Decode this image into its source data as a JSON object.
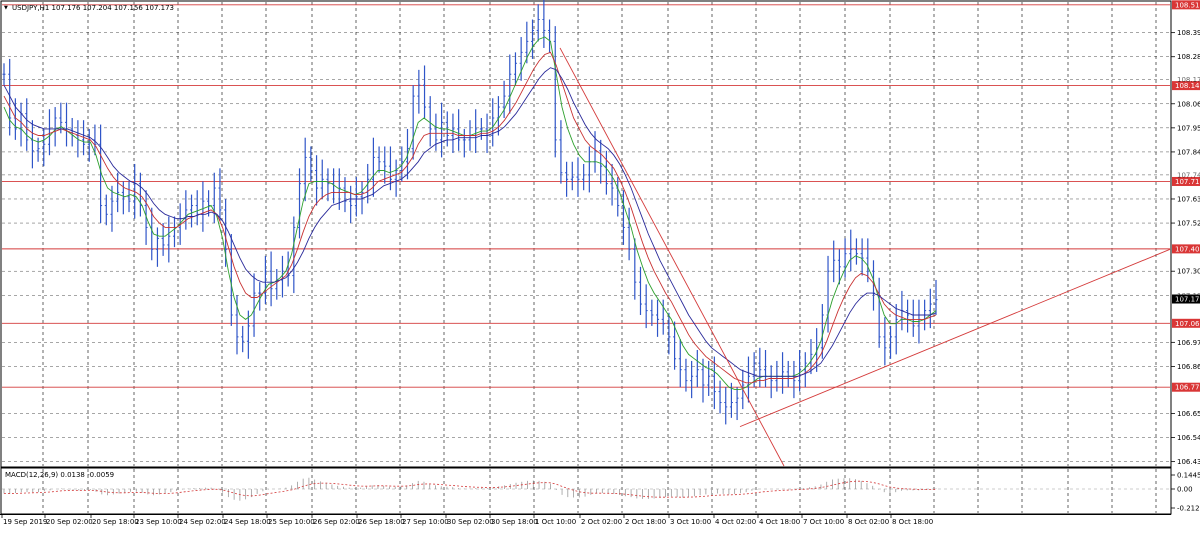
{
  "header": {
    "dropdown_glyph": "▼",
    "symbol_info": "USDJPY,H1  107.176 107.204 107.156 107.173"
  },
  "macd": {
    "label": "MACD(12,26,9) 0.0138 -0.0059",
    "ticks": [
      "0.1445",
      "0.00",
      "-0.2128"
    ]
  },
  "chart_data": {
    "type": "line",
    "title": "USDJPY,H1",
    "price_ticks": [
      "108.390",
      "108.280",
      "108.065",
      "107.955",
      "107.845",
      "107.630",
      "107.520",
      "107.300",
      "106.975",
      "106.865",
      "106.650",
      "106.540",
      "106.430"
    ],
    "price_partial_ticks": [
      "108.175",
      "107.740",
      "107.190"
    ],
    "ylim": [
      106.41,
      108.53
    ],
    "time_labels": [
      "19 Sep 2019",
      "20 Sep 02:00",
      "20 Sep 18:00",
      "23 Sep 10:00",
      "24 Sep 02:00",
      "24 Sep 18:00",
      "25 Sep 10:00",
      "26 Sep 02:00",
      "26 Sep 18:00",
      "27 Sep 10:00",
      "30 Sep 02:00",
      "30 Sep 18:00",
      "1 Oct 10:00",
      "2 Oct 02:00",
      "2 Oct 18:00",
      "3 Oct 10:00",
      "4 Oct 02:00",
      "4 Oct 18:00",
      "7 Oct 10:00",
      "8 Oct 02:00",
      "8 Oct 18:00"
    ],
    "current_price": "107.173",
    "levels": [
      "108.517",
      "108.148",
      "107.710",
      "107.402",
      "107.062",
      "106.770"
    ],
    "series": [
      {
        "name": "USDJPY close",
        "color": "#2f55c8",
        "values": [
          108.2,
          108.0,
          107.95,
          108.02,
          107.9,
          107.85,
          107.86,
          107.88,
          107.95,
          108.0,
          107.98,
          107.95,
          107.92,
          107.9,
          107.88,
          107.9,
          107.88,
          107.6,
          107.56,
          107.62,
          107.66,
          107.64,
          107.62,
          107.7,
          107.6,
          107.5,
          107.4,
          107.45,
          107.42,
          107.46,
          107.5,
          107.54,
          107.58,
          107.6,
          107.56,
          107.62,
          107.6,
          107.68,
          107.58,
          107.4,
          107.1,
          107.0,
          106.98,
          107.05,
          107.2,
          107.2,
          107.3,
          107.22,
          107.26,
          107.3,
          107.28,
          107.5,
          107.7,
          107.82,
          107.76,
          107.68,
          107.72,
          107.7,
          107.66,
          107.68,
          107.62,
          107.6,
          107.64,
          107.66,
          107.72,
          107.82,
          107.8,
          107.78,
          107.72,
          107.76,
          107.8,
          107.86,
          108.1,
          108.15,
          108.05,
          107.95,
          107.9,
          107.98,
          107.92,
          107.95,
          107.9,
          107.9,
          107.92,
          107.95,
          107.95,
          107.92,
          108.0,
          108.05,
          108.1,
          108.2,
          108.25,
          108.3,
          108.35,
          108.4,
          108.45,
          108.4,
          108.35,
          107.9,
          107.75,
          107.72,
          107.73,
          107.72,
          107.74,
          107.8,
          107.85,
          107.78,
          107.7,
          107.68,
          107.6,
          107.5,
          107.4,
          107.25,
          107.15,
          107.12,
          107.1,
          107.08,
          107.06,
          107.0,
          106.9,
          106.85,
          106.8,
          106.82,
          106.85,
          106.78,
          106.82,
          106.75,
          106.7,
          106.68,
          106.7,
          106.72,
          106.78,
          106.82,
          106.88,
          106.85,
          106.82,
          106.8,
          106.82,
          106.84,
          106.82,
          106.8,
          106.85,
          106.88,
          106.92,
          106.95,
          107.1,
          107.3,
          107.35,
          107.32,
          107.38,
          107.4,
          107.38,
          107.36,
          107.3,
          107.2,
          107.0,
          106.95,
          107.0,
          107.08,
          107.12,
          107.1,
          107.05,
          107.08,
          107.12,
          107.15,
          107.17
        ]
      },
      {
        "name": "MA fast",
        "color": "#2ea02e",
        "values": [
          108.05,
          107.99,
          107.96,
          107.95,
          107.92,
          107.9,
          107.89,
          107.9,
          107.92,
          107.95,
          107.96,
          107.94,
          107.92,
          107.9,
          107.89,
          107.89,
          107.83,
          107.74,
          107.68,
          107.66,
          107.65,
          107.64,
          107.65,
          107.64,
          107.6,
          107.53,
          107.47,
          107.46,
          107.46,
          107.48,
          107.5,
          107.53,
          107.56,
          107.57,
          107.58,
          107.59,
          107.6,
          107.55,
          107.45,
          107.3,
          107.18,
          107.1,
          107.08,
          107.1,
          107.15,
          107.2,
          107.24,
          107.25,
          107.27,
          107.3,
          107.38,
          107.5,
          107.62,
          107.7,
          107.71,
          107.71,
          107.71,
          107.7,
          107.68,
          107.67,
          107.66,
          107.65,
          107.66,
          107.69,
          107.73,
          107.76,
          107.76,
          107.75,
          107.76,
          107.78,
          107.82,
          107.9,
          107.98,
          108.0,
          107.98,
          107.96,
          107.95,
          107.95,
          107.94,
          107.93,
          107.92,
          107.92,
          107.93,
          107.94,
          107.94,
          107.96,
          108.0,
          108.04,
          108.1,
          108.16,
          108.22,
          108.28,
          108.33,
          108.36,
          108.37,
          108.35,
          108.2,
          108.05,
          107.95,
          107.88,
          107.83,
          107.8,
          107.8,
          107.8,
          107.79,
          107.76,
          107.72,
          107.66,
          107.58,
          107.5,
          107.4,
          107.32,
          107.25,
          107.2,
          107.16,
          107.12,
          107.08,
          107.02,
          106.96,
          106.92,
          106.9,
          106.88,
          106.86,
          106.85,
          106.83,
          106.8,
          106.77,
          106.76,
          106.76,
          106.77,
          106.79,
          106.81,
          106.82,
          106.82,
          106.82,
          106.82,
          106.82,
          106.82,
          106.83,
          106.85,
          106.88,
          106.92,
          106.98,
          107.08,
          107.17,
          107.24,
          107.3,
          107.35,
          107.37,
          107.36,
          107.33,
          107.27,
          107.18,
          107.1,
          107.06,
          107.06,
          107.08,
          107.08,
          107.07,
          107.07,
          107.08,
          107.1,
          107.12
        ]
      },
      {
        "name": "MA medium",
        "color": "#c83232",
        "values": [
          108.1,
          108.05,
          108.0,
          107.98,
          107.95,
          107.93,
          107.92,
          107.92,
          107.93,
          107.94,
          107.95,
          107.94,
          107.93,
          107.92,
          107.91,
          107.9,
          107.87,
          107.82,
          107.77,
          107.73,
          107.7,
          107.68,
          107.67,
          107.66,
          107.64,
          107.6,
          107.55,
          107.52,
          107.5,
          107.5,
          107.5,
          107.52,
          107.54,
          107.55,
          107.56,
          107.57,
          107.58,
          107.56,
          107.5,
          107.41,
          107.32,
          107.25,
          107.2,
          107.18,
          107.18,
          107.2,
          107.22,
          107.24,
          107.26,
          107.28,
          107.33,
          107.4,
          107.48,
          107.55,
          107.6,
          107.63,
          107.65,
          107.66,
          107.66,
          107.66,
          107.66,
          107.65,
          107.65,
          107.66,
          107.68,
          107.71,
          107.72,
          107.73,
          107.74,
          107.75,
          107.78,
          107.82,
          107.88,
          107.92,
          107.93,
          107.93,
          107.93,
          107.93,
          107.93,
          107.92,
          107.92,
          107.92,
          107.92,
          107.93,
          107.93,
          107.94,
          107.96,
          107.99,
          108.03,
          108.07,
          108.12,
          108.17,
          108.22,
          108.26,
          108.29,
          108.3,
          108.24,
          108.16,
          108.08,
          108.0,
          107.95,
          107.9,
          107.87,
          107.85,
          107.83,
          107.8,
          107.77,
          107.72,
          107.66,
          107.59,
          107.51,
          107.43,
          107.36,
          107.3,
          107.25,
          107.2,
          107.16,
          107.11,
          107.06,
          107.01,
          106.97,
          106.94,
          106.91,
          106.89,
          106.87,
          106.85,
          106.83,
          106.81,
          106.8,
          106.79,
          106.79,
          106.8,
          106.8,
          106.81,
          106.81,
          106.81,
          106.81,
          106.81,
          106.82,
          106.83,
          106.85,
          106.88,
          106.92,
          106.98,
          107.05,
          107.12,
          107.18,
          107.23,
          107.27,
          107.29,
          107.28,
          107.25,
          107.2,
          107.15,
          107.12,
          107.1,
          107.09,
          107.08,
          107.08,
          107.08,
          107.08,
          107.09,
          107.1
        ]
      },
      {
        "name": "MA slow",
        "color": "#2a2a9a",
        "values": [
          108.15,
          108.1,
          108.05,
          108.02,
          107.99,
          107.97,
          107.96,
          107.95,
          107.95,
          107.95,
          107.95,
          107.95,
          107.94,
          107.93,
          107.92,
          107.91,
          107.89,
          107.86,
          107.82,
          107.78,
          107.75,
          107.73,
          107.71,
          107.7,
          107.68,
          107.65,
          107.61,
          107.58,
          107.56,
          107.55,
          107.54,
          107.54,
          107.55,
          107.55,
          107.56,
          107.56,
          107.57,
          107.56,
          107.53,
          107.48,
          107.42,
          107.36,
          107.31,
          107.28,
          107.26,
          107.25,
          107.25,
          107.25,
          107.26,
          107.27,
          107.3,
          107.34,
          107.39,
          107.45,
          107.5,
          107.54,
          107.57,
          107.6,
          107.61,
          107.62,
          107.63,
          107.63,
          107.63,
          107.64,
          107.65,
          107.67,
          107.69,
          107.7,
          107.71,
          107.72,
          107.74,
          107.77,
          107.8,
          107.84,
          107.86,
          107.88,
          107.89,
          107.9,
          107.9,
          107.91,
          107.91,
          107.91,
          107.91,
          107.92,
          107.92,
          107.93,
          107.94,
          107.96,
          107.99,
          108.02,
          108.06,
          108.1,
          108.14,
          108.18,
          108.21,
          108.23,
          108.22,
          108.18,
          108.13,
          108.07,
          108.02,
          107.97,
          107.93,
          107.9,
          107.88,
          107.86,
          107.83,
          107.79,
          107.74,
          107.68,
          107.61,
          107.54,
          107.47,
          107.41,
          107.35,
          107.3,
          107.25,
          107.2,
          107.15,
          107.1,
          107.06,
          107.02,
          106.98,
          106.95,
          106.93,
          106.91,
          106.89,
          106.87,
          106.85,
          106.84,
          106.83,
          106.82,
          106.82,
          106.82,
          106.82,
          106.82,
          106.82,
          106.82,
          106.82,
          106.83,
          106.84,
          106.86,
          106.88,
          106.92,
          106.96,
          107.01,
          107.06,
          107.11,
          107.15,
          107.18,
          107.2,
          107.2,
          107.19,
          107.17,
          107.15,
          107.13,
          107.12,
          107.11,
          107.1,
          107.1,
          107.1,
          107.1,
          107.11
        ]
      }
    ],
    "grid": true
  }
}
